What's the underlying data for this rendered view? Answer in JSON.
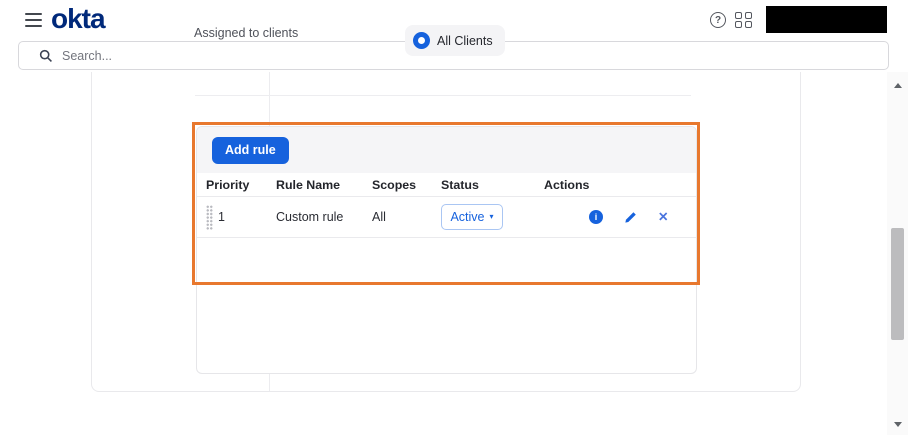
{
  "topbar": {
    "logo_text": "okta",
    "search_placeholder": "Search..."
  },
  "content": {
    "assigned_to_clients_label": "Assigned to clients",
    "all_clients_chip": "All Clients"
  },
  "rules_section": {
    "add_rule_button": "Add rule",
    "table": {
      "columns": [
        "Priority",
        "Rule Name",
        "Scopes",
        "Status",
        "Actions"
      ],
      "rows": [
        {
          "priority": "1",
          "rule_name": "Custom rule",
          "scopes": "All",
          "status": "Active"
        }
      ]
    }
  },
  "icons": {
    "help": "?",
    "info": "i",
    "close": "✕",
    "caret_down": "▾"
  },
  "colors": {
    "brand_navy": "#00297a",
    "primary_blue": "#1662dd",
    "highlight_orange": "#e8782e"
  }
}
